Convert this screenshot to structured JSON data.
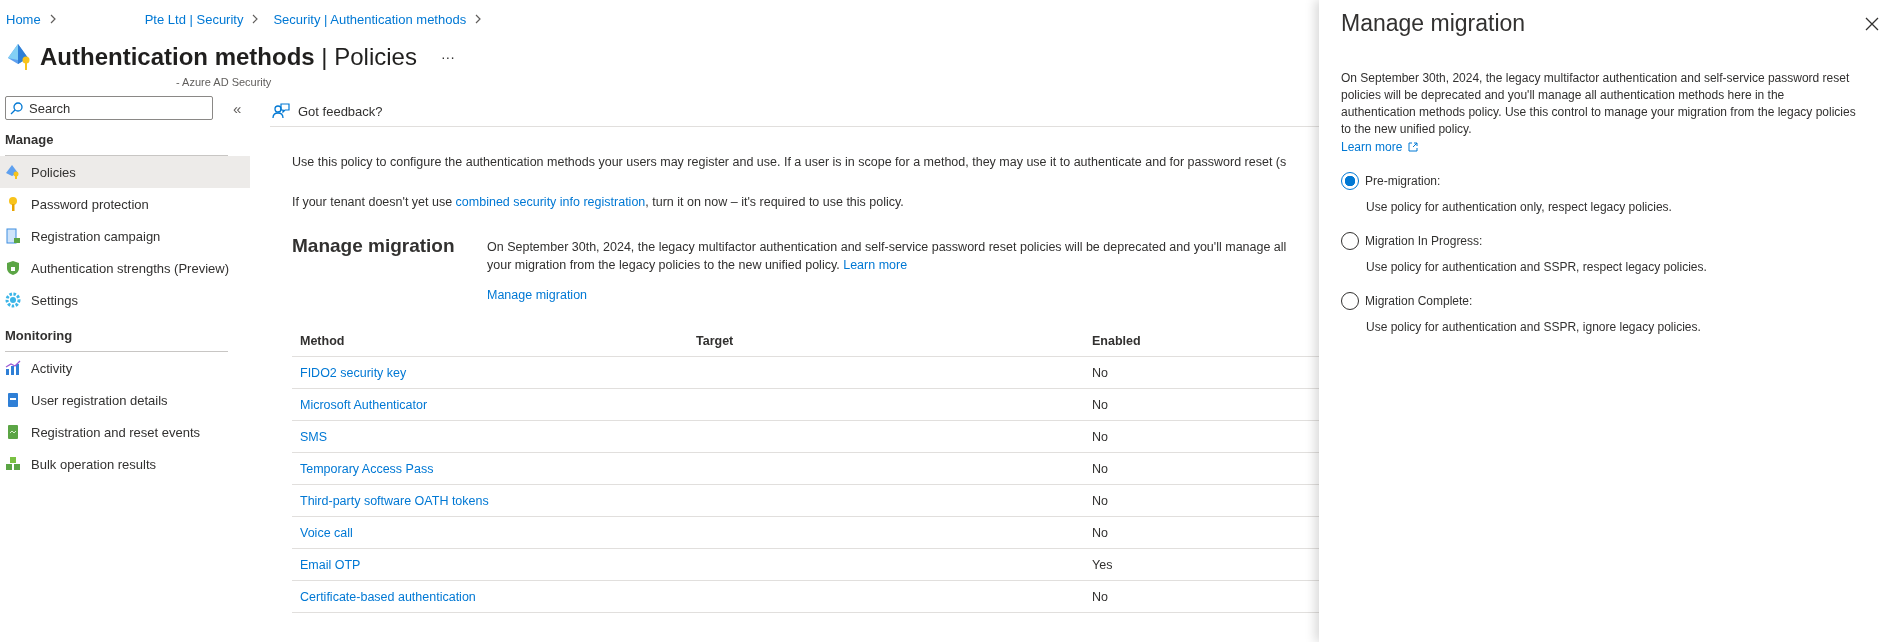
{
  "breadcrumb": [
    {
      "label": "Home"
    },
    {
      "label": "Pte Ltd | Security"
    },
    {
      "label": "Security | Authentication methods"
    }
  ],
  "page": {
    "title": "Authentication methods",
    "separator": "|",
    "section": "Policies",
    "subtitle": "- Azure AD Security",
    "more": "···"
  },
  "sidebar": {
    "search": {
      "placeholder": "Search"
    },
    "collapse": "«",
    "groups": [
      {
        "heading": "Manage",
        "items": [
          {
            "label": "Policies",
            "kind": "policy",
            "selected": true
          },
          {
            "label": "Password protection",
            "kind": "key",
            "selected": false
          },
          {
            "label": "Registration campaign",
            "kind": "campaign",
            "selected": false
          },
          {
            "label": "Authentication strengths (Preview)",
            "kind": "shield",
            "selected": false
          },
          {
            "label": "Settings",
            "kind": "gear",
            "selected": false
          }
        ]
      },
      {
        "heading": "Monitoring",
        "items": [
          {
            "label": "Activity",
            "kind": "chart",
            "selected": false
          },
          {
            "label": "User registration details",
            "kind": "book",
            "selected": false
          },
          {
            "label": "Registration and reset events",
            "kind": "log",
            "selected": false
          },
          {
            "label": "Bulk operation results",
            "kind": "cubes",
            "selected": false
          }
        ]
      }
    ]
  },
  "toolbar": {
    "feedback": "Got feedback?"
  },
  "intro": {
    "text": "Use this policy to configure the authentication methods your users may register and use. If a user is in scope for a method, they may use it to authenticate and for password reset (s",
    "tenant_before": "If your tenant doesn't yet use ",
    "tenant_link": "combined security info registration",
    "tenant_after": ", turn it on now – it's required to use this policy."
  },
  "migration": {
    "heading": "Manage migration",
    "lines": [
      "On September 30th, 2024, the legacy multifactor authentication and self-service password reset policies will be deprecated and you'll manage all",
      "your migration from the legacy policies to the new unified policy."
    ],
    "learn_more": "Learn more",
    "action": "Manage migration"
  },
  "table": {
    "columns": [
      "Method",
      "Target",
      "Enabled"
    ],
    "rows": [
      {
        "method": "FIDO2 security key",
        "enabled": "No"
      },
      {
        "method": "Microsoft Authenticator",
        "enabled": "No"
      },
      {
        "method": "SMS",
        "enabled": "No"
      },
      {
        "method": "Temporary Access Pass",
        "enabled": "No"
      },
      {
        "method": "Third-party software OATH tokens",
        "enabled": "No"
      },
      {
        "method": "Voice call",
        "enabled": "No"
      },
      {
        "method": "Email OTP",
        "enabled": "Yes"
      },
      {
        "method": "Certificate-based authentication",
        "enabled": "No"
      }
    ]
  },
  "panel": {
    "title": "Manage migration",
    "description": "On September 30th, 2024, the legacy multifactor authentication and self-service password reset policies will be deprecated and you'll manage all authentication methods here in the authentication methods policy. Use this control to manage your migration from the legacy policies to the new unified policy.",
    "learn_more": "Learn more",
    "options": [
      {
        "label": "Pre-migration:",
        "description": "Use policy for authentication only, respect legacy policies.",
        "selected": true
      },
      {
        "label": "Migration In Progress:",
        "description": "Use policy for authentication and SSPR, respect legacy policies.",
        "selected": false
      },
      {
        "label": "Migration Complete:",
        "description": "Use policy for authentication and SSPR, ignore legacy policies.",
        "selected": false
      }
    ]
  }
}
